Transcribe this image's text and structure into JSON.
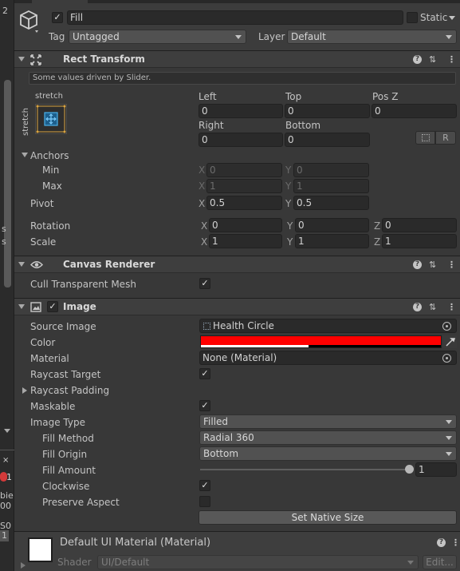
{
  "left_edge": {
    "number_top": "2",
    "s1": "s",
    "s2": "s",
    "badge": "1",
    "frag1": "bie",
    "frag2": "00",
    "frag3": "S0",
    "frag4": "1"
  },
  "gameobject": {
    "name": "Fill",
    "active": true,
    "static_label": "Static",
    "tag_label": "Tag",
    "tag_value": "Untagged",
    "layer_label": "Layer",
    "layer_value": "Default"
  },
  "rect_transform": {
    "title": "Rect Transform",
    "note": "Some values driven by Slider.",
    "anchor_preset": "stretch",
    "anchor_preset_side": "stretch",
    "left_label": "Left",
    "left": "0",
    "top_label": "Top",
    "top": "0",
    "posz_label": "Pos Z",
    "posz": "0",
    "right_label": "Right",
    "right": "0",
    "bottom_label": "Bottom",
    "bottom": "0",
    "r_button": "R",
    "anchors_label": "Anchors",
    "min_label": "Min",
    "min_x": "0",
    "min_y": "0",
    "max_label": "Max",
    "max_x": "1",
    "max_y": "1",
    "pivot_label": "Pivot",
    "pivot_x": "0.5",
    "pivot_y": "0.5",
    "rotation_label": "Rotation",
    "rot_x": "0",
    "rot_y": "0",
    "rot_z": "0",
    "scale_label": "Scale",
    "scale_x": "1",
    "scale_y": "1",
    "scale_z": "1",
    "x": "X",
    "y": "Y",
    "z": "Z"
  },
  "canvas_renderer": {
    "title": "Canvas Renderer",
    "cull_label": "Cull Transparent Mesh",
    "cull": true
  },
  "image": {
    "title": "Image",
    "source_image_label": "Source Image",
    "source_image": "Health Circle",
    "color_label": "Color",
    "color": "#ff0000",
    "material_label": "Material",
    "material": "None (Material)",
    "raycast_target_label": "Raycast Target",
    "raycast_target": true,
    "raycast_padding_label": "Raycast Padding",
    "maskable_label": "Maskable",
    "maskable": true,
    "image_type_label": "Image Type",
    "image_type": "Filled",
    "fill_method_label": "Fill Method",
    "fill_method": "Radial 360",
    "fill_origin_label": "Fill Origin",
    "fill_origin": "Bottom",
    "fill_amount_label": "Fill Amount",
    "fill_amount": "1",
    "fill_amount_value": 1,
    "clockwise_label": "Clockwise",
    "clockwise": true,
    "preserve_aspect_label": "Preserve Aspect",
    "preserve_aspect": false,
    "set_native_size": "Set Native Size"
  },
  "material_footer": {
    "title": "Default UI Material (Material)",
    "shader_label": "Shader",
    "shader_value": "UI/Default",
    "edit_button": "Edit..."
  },
  "colors": {
    "panel": "#383838",
    "header": "#3e3e3e",
    "field": "#2a2a2a",
    "accent": "#4a9be8",
    "color_swatch": "#ff0000"
  }
}
